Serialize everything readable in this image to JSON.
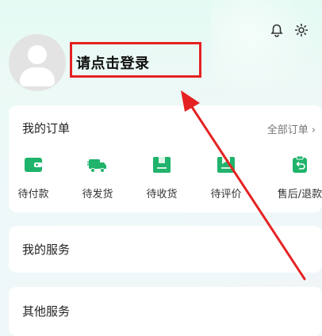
{
  "header": {
    "login_prompt": "请点击登录"
  },
  "orders": {
    "title": "我的订单",
    "all_orders_label": "全部订单",
    "items": [
      {
        "label": "待付款",
        "icon": "wallet-icon"
      },
      {
        "label": "待发货",
        "icon": "truck-icon"
      },
      {
        "label": "待收货",
        "icon": "box-icon"
      },
      {
        "label": "待评价",
        "icon": "review-icon"
      },
      {
        "label": "售后/退款",
        "icon": "refund-icon"
      }
    ]
  },
  "services": {
    "title": "我的服务"
  },
  "other": {
    "title": "其他服务"
  },
  "colors": {
    "accent": "#1fb36b",
    "annotation": "#e52222"
  }
}
